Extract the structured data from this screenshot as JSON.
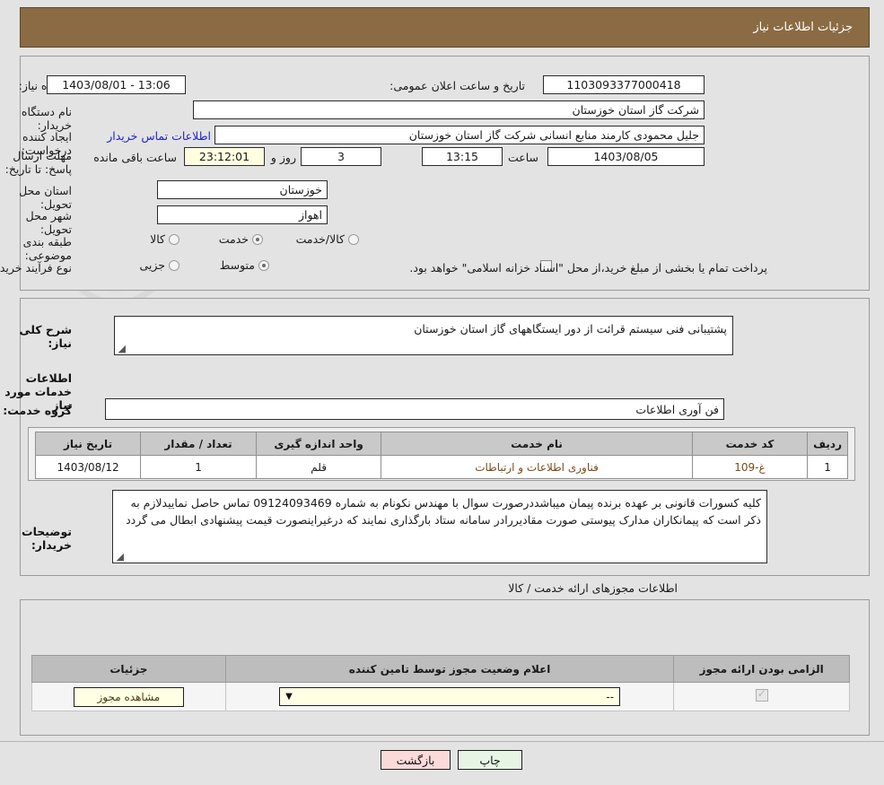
{
  "header": {
    "title": "جزئیات اطلاعات نیاز"
  },
  "watermark": {
    "text": "AriaTender.net"
  },
  "form": {
    "need_number_label": "شماره نیاز:",
    "need_number_value": "1103093377000418",
    "public_announce_label": "تاریخ و ساعت اعلان عمومی:",
    "public_announce_value": "1403/08/01 - 13:06",
    "buyer_org_label": "نام دستگاه خریدار:",
    "buyer_org_value": "شرکت گاز استان خوزستان",
    "buyer_org_value2": "شرکت گاز استان خوزستان",
    "creator_label": "ایجاد کننده درخواست:",
    "creator_value": "جلیل محمودی کارمند منابع انسانی شرکت گاز استان خوزستان",
    "contact_link": "اطلاعات تماس خریدار",
    "deadline_label": "مهلت ارسال پاسخ: تا تاریخ:",
    "deadline_date": "1403/08/05",
    "deadline_time_label": "ساعت",
    "deadline_time": "13:15",
    "remaining_days": "3",
    "remaining_days_label": "روز و",
    "remaining_clock": "23:12:01",
    "remaining_suffix": "ساعت باقی مانده",
    "province_label": "استان محل تحویل:",
    "province_value": "خوزستان",
    "city_label": "شهر محل تحویل:",
    "city_value": "اهواز",
    "category_label": "طبقه بندی موضوعی:",
    "category_options": [
      {
        "label": "کالا",
        "selected": false
      },
      {
        "label": "خدمت",
        "selected": true
      },
      {
        "label": "کالا/خدمت",
        "selected": false
      }
    ],
    "process_label": "نوع فرآیند خرید :",
    "process_options": [
      {
        "label": "جزیی",
        "selected": false
      },
      {
        "label": "متوسط",
        "selected": true
      }
    ],
    "treasury_note": "پرداخت تمام یا بخشی از مبلغ خرید،از محل \"اسناد خزانه اسلامی\" خواهد بود."
  },
  "middle": {
    "summary_label": "شرح کلی نیاز:",
    "summary_value": "پشتیبانی فنی سیستم قرائت از دور ایستگاههای گاز استان خوزستان",
    "services_section_title": "اطلاعات خدمات مورد نیاز",
    "service_group_label": "گروه خدمت:",
    "service_group_value": "فن آوری اطلاعات",
    "table": {
      "headers": [
        "ردیف",
        "کد خدمت",
        "نام خدمت",
        "واحد اندازه گیری",
        "تعداد / مقدار",
        "تاریخ نیاز"
      ],
      "rows": [
        {
          "row": "1",
          "code": "غ-109",
          "name": "فناوری اطلاعات و ارتباطات",
          "unit": "قلم",
          "qty": "1",
          "date": "1403/08/12"
        }
      ]
    },
    "notes_label": "توضیحات خریدار:",
    "notes_value": "کلیه کسورات قانونی بر عهده برنده پیمان میباشددرصورت سوال با مهندس نکونام به شماره 09124093469 تماس حاصل نماییدلازم به ذکر است که پیمانکاران مدارک پیوستی صورت مقادیررادر سامانه ستاد بارگذاری نمایند که درغیراینصورت قیمت پیشنهادی ابطال می گردد"
  },
  "permits": {
    "caption": "اطلاعات مجوزهای ارائه خدمت / کالا",
    "headers": [
      "الزامی بودن ارائه مجوز",
      "اعلام وضعیت مجوز توسط تامین کننده",
      "جزئیات"
    ],
    "rows": [
      {
        "required_checked": true,
        "status_value": "--",
        "detail_button": "مشاهده مجوز"
      }
    ]
  },
  "footer": {
    "print_label": "چاپ",
    "back_label": "بازگشت"
  },
  "colors": {
    "header_bg": "#8b6b43",
    "page_bg": "#e3e3e3",
    "link": "#2222cc",
    "print_btn": "#e7f6e4",
    "back_btn": "#fcdada",
    "countdown_bg": "#ffffe0",
    "table_header_bg": "#c9c9c9"
  }
}
